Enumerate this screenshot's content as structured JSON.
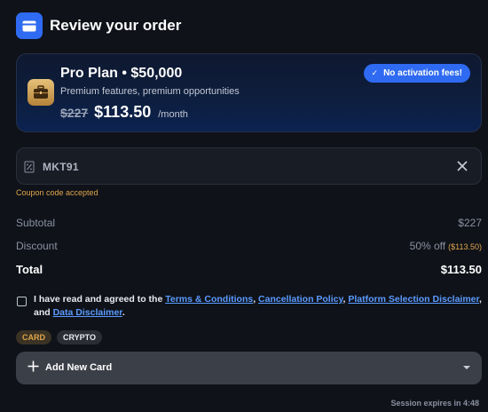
{
  "header": {
    "title": "Review your order",
    "icon": "card-icon"
  },
  "plan": {
    "name": "Pro Plan • $50,000",
    "subtitle": "Premium features, premium opportunities",
    "price_old": "$227",
    "price_new": "$113.50",
    "period": "/month",
    "badge": "No activation fees!",
    "icon": "briefcase-icon"
  },
  "coupon": {
    "code": "MKT91",
    "status": "Coupon code accepted"
  },
  "summary": {
    "subtotal_label": "Subtotal",
    "subtotal_value": "$227",
    "discount_label": "Discount",
    "discount_value": "50% off",
    "discount_amount": "($113.50)",
    "total_label": "Total",
    "total_value": "$113.50"
  },
  "agreement": {
    "prefix": "I have read and agreed to the ",
    "link1": "Terms & Conditions",
    "sep1": ", ",
    "link2": "Cancellation Policy",
    "sep2": ", ",
    "link3": "Platform Selection Disclaimer",
    "sep3": ", and ",
    "link4": "Data Disclaimer",
    "suffix": "."
  },
  "payment_methods": [
    "CARD",
    "CRYPTO"
  ],
  "add_card": {
    "label": "Add New Card"
  },
  "session": "Session expires in 4:48",
  "colors": {
    "accent": "#2f6af3",
    "warning": "#e0a54a",
    "link": "#5b9bff",
    "background": "#0f1219"
  }
}
